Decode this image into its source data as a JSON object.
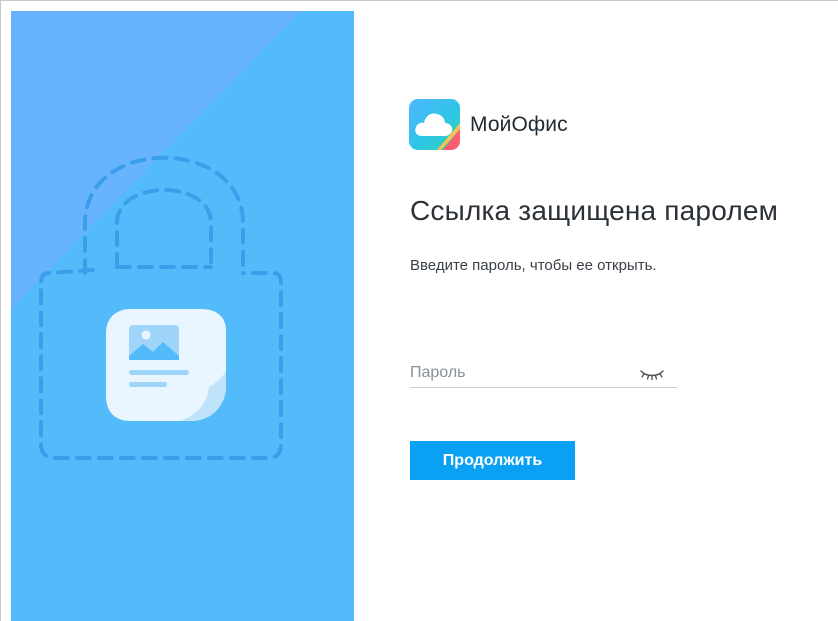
{
  "brand": {
    "name": "МойОфис",
    "logo_icon": "cloud-logo-icon"
  },
  "illustration": {
    "lock_icon": "dashed-lock-icon",
    "document_icon": "image-document-icon"
  },
  "form": {
    "heading": "Ссылка защищена паролем",
    "subtitle": "Введите пароль, чтобы ее открыть.",
    "password_placeholder": "Пароль",
    "password_value": "",
    "visibility_icon": "eye-closed-icon",
    "submit_label": "Продолжить"
  },
  "colors": {
    "panel_blue": "#54bbfb",
    "panel_blue_light": "#67b3fc",
    "button_blue": "#0aa0f3",
    "lock_dash": "#3a9fea"
  }
}
